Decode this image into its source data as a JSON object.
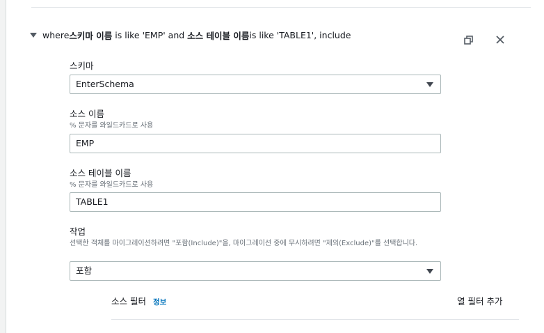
{
  "rule": {
    "prefix": "where ",
    "schema_label": "스키마 이름",
    "mid1": " is like 'EMP' and ",
    "table_label": "소스 테이블 이름",
    "mid2": " is like 'TABLE1', include"
  },
  "schema": {
    "label": "스키마",
    "value": "EnterSchema"
  },
  "source_name": {
    "label": "소스 이름",
    "hint": "% 문자를 와일드카드로 사용",
    "value": "EMP"
  },
  "source_table": {
    "label": "소스 테이블 이름",
    "hint": "% 문자를 와일드카드로 사용",
    "value": "TABLE1"
  },
  "action": {
    "label": "작업",
    "hint": "선택한 객체를 마이그레이션하려면 \"포함(Include)\"을, 마이그레이션 중에 무시하려면 \"제외(Exclude)\"를 선택합니다.",
    "value": "포함"
  },
  "source_filter": {
    "label": "소스 필터",
    "info": "정보",
    "add_label": "열 필터 추가"
  },
  "icons": {
    "expand": "caret-down-icon",
    "duplicate": "copy-icon",
    "remove": "close-icon"
  }
}
